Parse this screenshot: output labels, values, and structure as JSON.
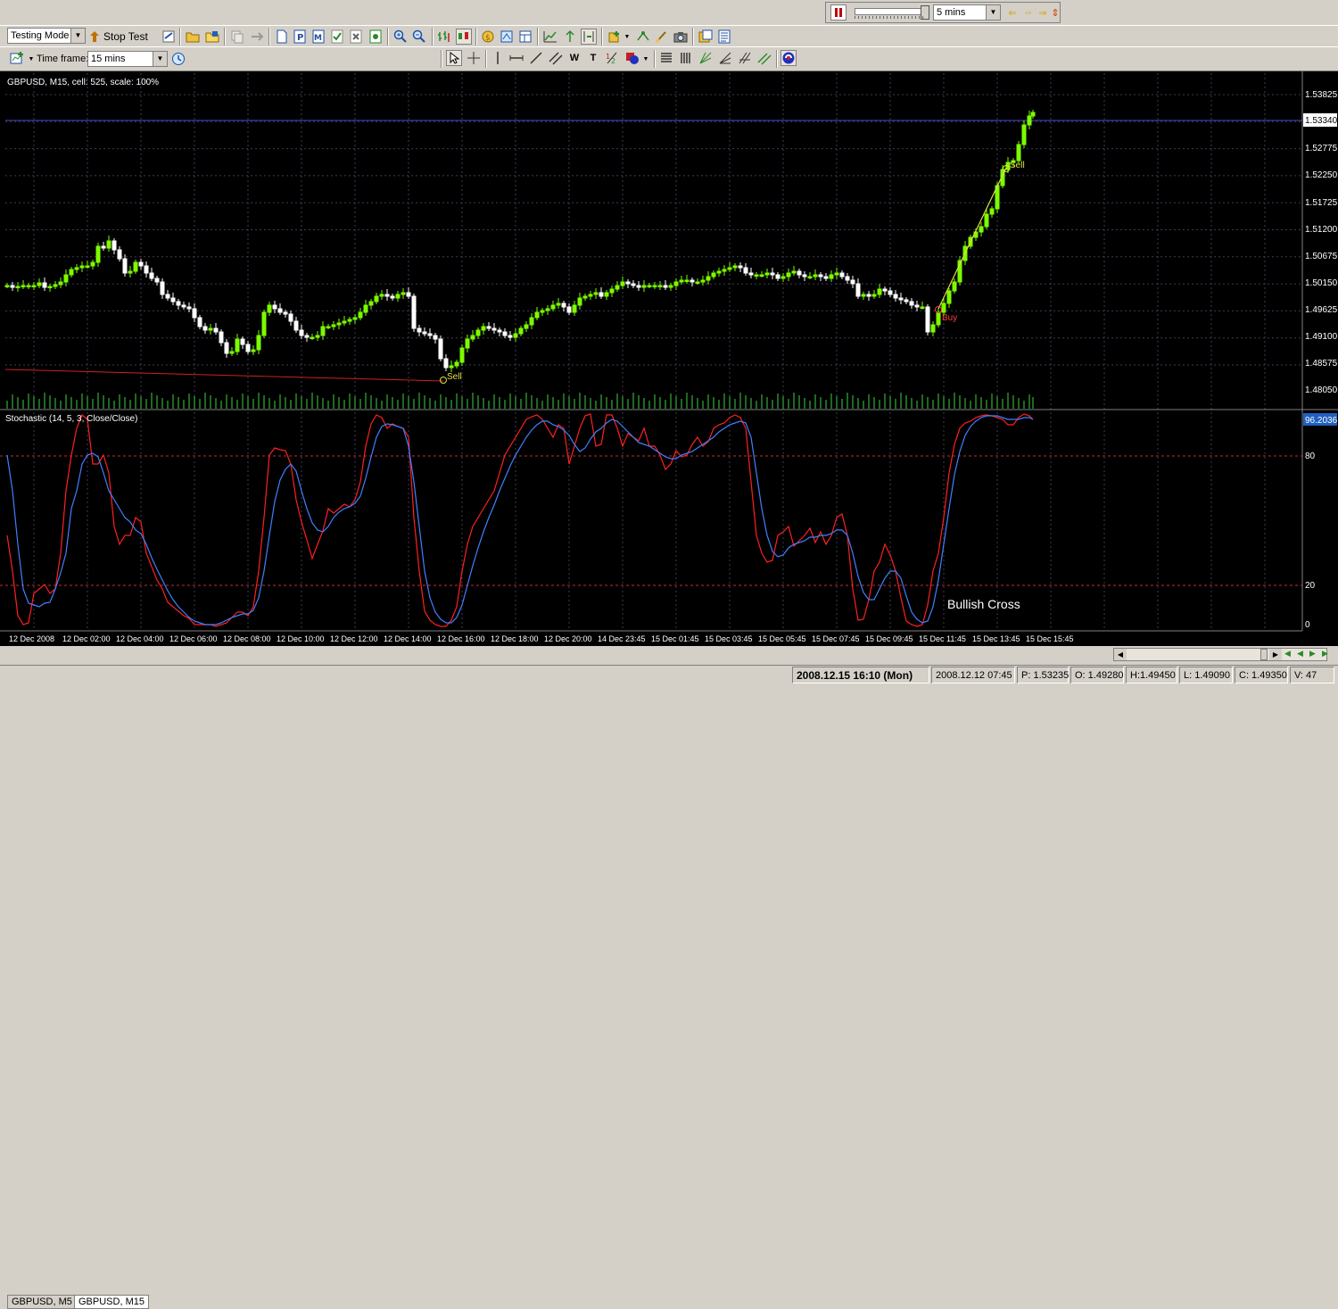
{
  "tester_bar": {
    "timeframe_value": "5 mins"
  },
  "toolbar": {
    "mode_value": "Testing Mode",
    "stop_label": "Stop Test",
    "timeframe_label": "Time frame:",
    "timeframe_value": "15 mins"
  },
  "chart": {
    "main_title": "GBPUSD, M15, cell: 525, scale: 100%",
    "price_labels": [
      "1.53825",
      "1.52775",
      "1.52250",
      "1.51725",
      "1.51200",
      "1.50675",
      "1.50150",
      "1.49625",
      "1.49100",
      "1.48575",
      "1.48050"
    ],
    "current_price": "1.53340",
    "indicator_title": "Stochastic (14, 5, 3, Close/Close)",
    "indicator_value": "96.2036",
    "indicator_levels": [
      "80",
      "20",
      "0"
    ],
    "time_labels": [
      "12 Dec 2008",
      "12 Dec 02:00",
      "12 Dec 04:00",
      "12 Dec 06:00",
      "12 Dec 08:00",
      "12 Dec 10:00",
      "12 Dec 12:00",
      "12 Dec 14:00",
      "12 Dec 16:00",
      "12 Dec 18:00",
      "12 Dec 20:00",
      "14 Dec 23:45",
      "15 Dec 01:45",
      "15 Dec 03:45",
      "15 Dec 05:45",
      "15 Dec 07:45",
      "15 Dec 09:45",
      "15 Dec 11:45",
      "15 Dec 13:45",
      "15 Dec 15:45"
    ],
    "markers": {
      "sell_1": "Sell",
      "buy": "Buy",
      "sell_2": "Sell"
    },
    "annotation": "Bullish Cross",
    "colors": {
      "bull": "#7cfc00",
      "bear": "#ffffff",
      "grid": "#3c3c5a",
      "stoch_main": "#ff2020",
      "stoch_signal": "#4080ff",
      "level": "#c03030",
      "hline": "#4a4ad0"
    }
  },
  "tabs": [
    "GBPUSD, M5",
    "GBPUSD, M15"
  ],
  "status": {
    "datetime": "2008.12.15 16:10 (Mon)",
    "bar_time": "2008.12.12 07:45",
    "price": "P: 1.53235",
    "open": "O: 1.49280",
    "high": "H:1.49450",
    "low": "L: 1.49090",
    "close": "C: 1.49350",
    "volume": "V: 47"
  }
}
